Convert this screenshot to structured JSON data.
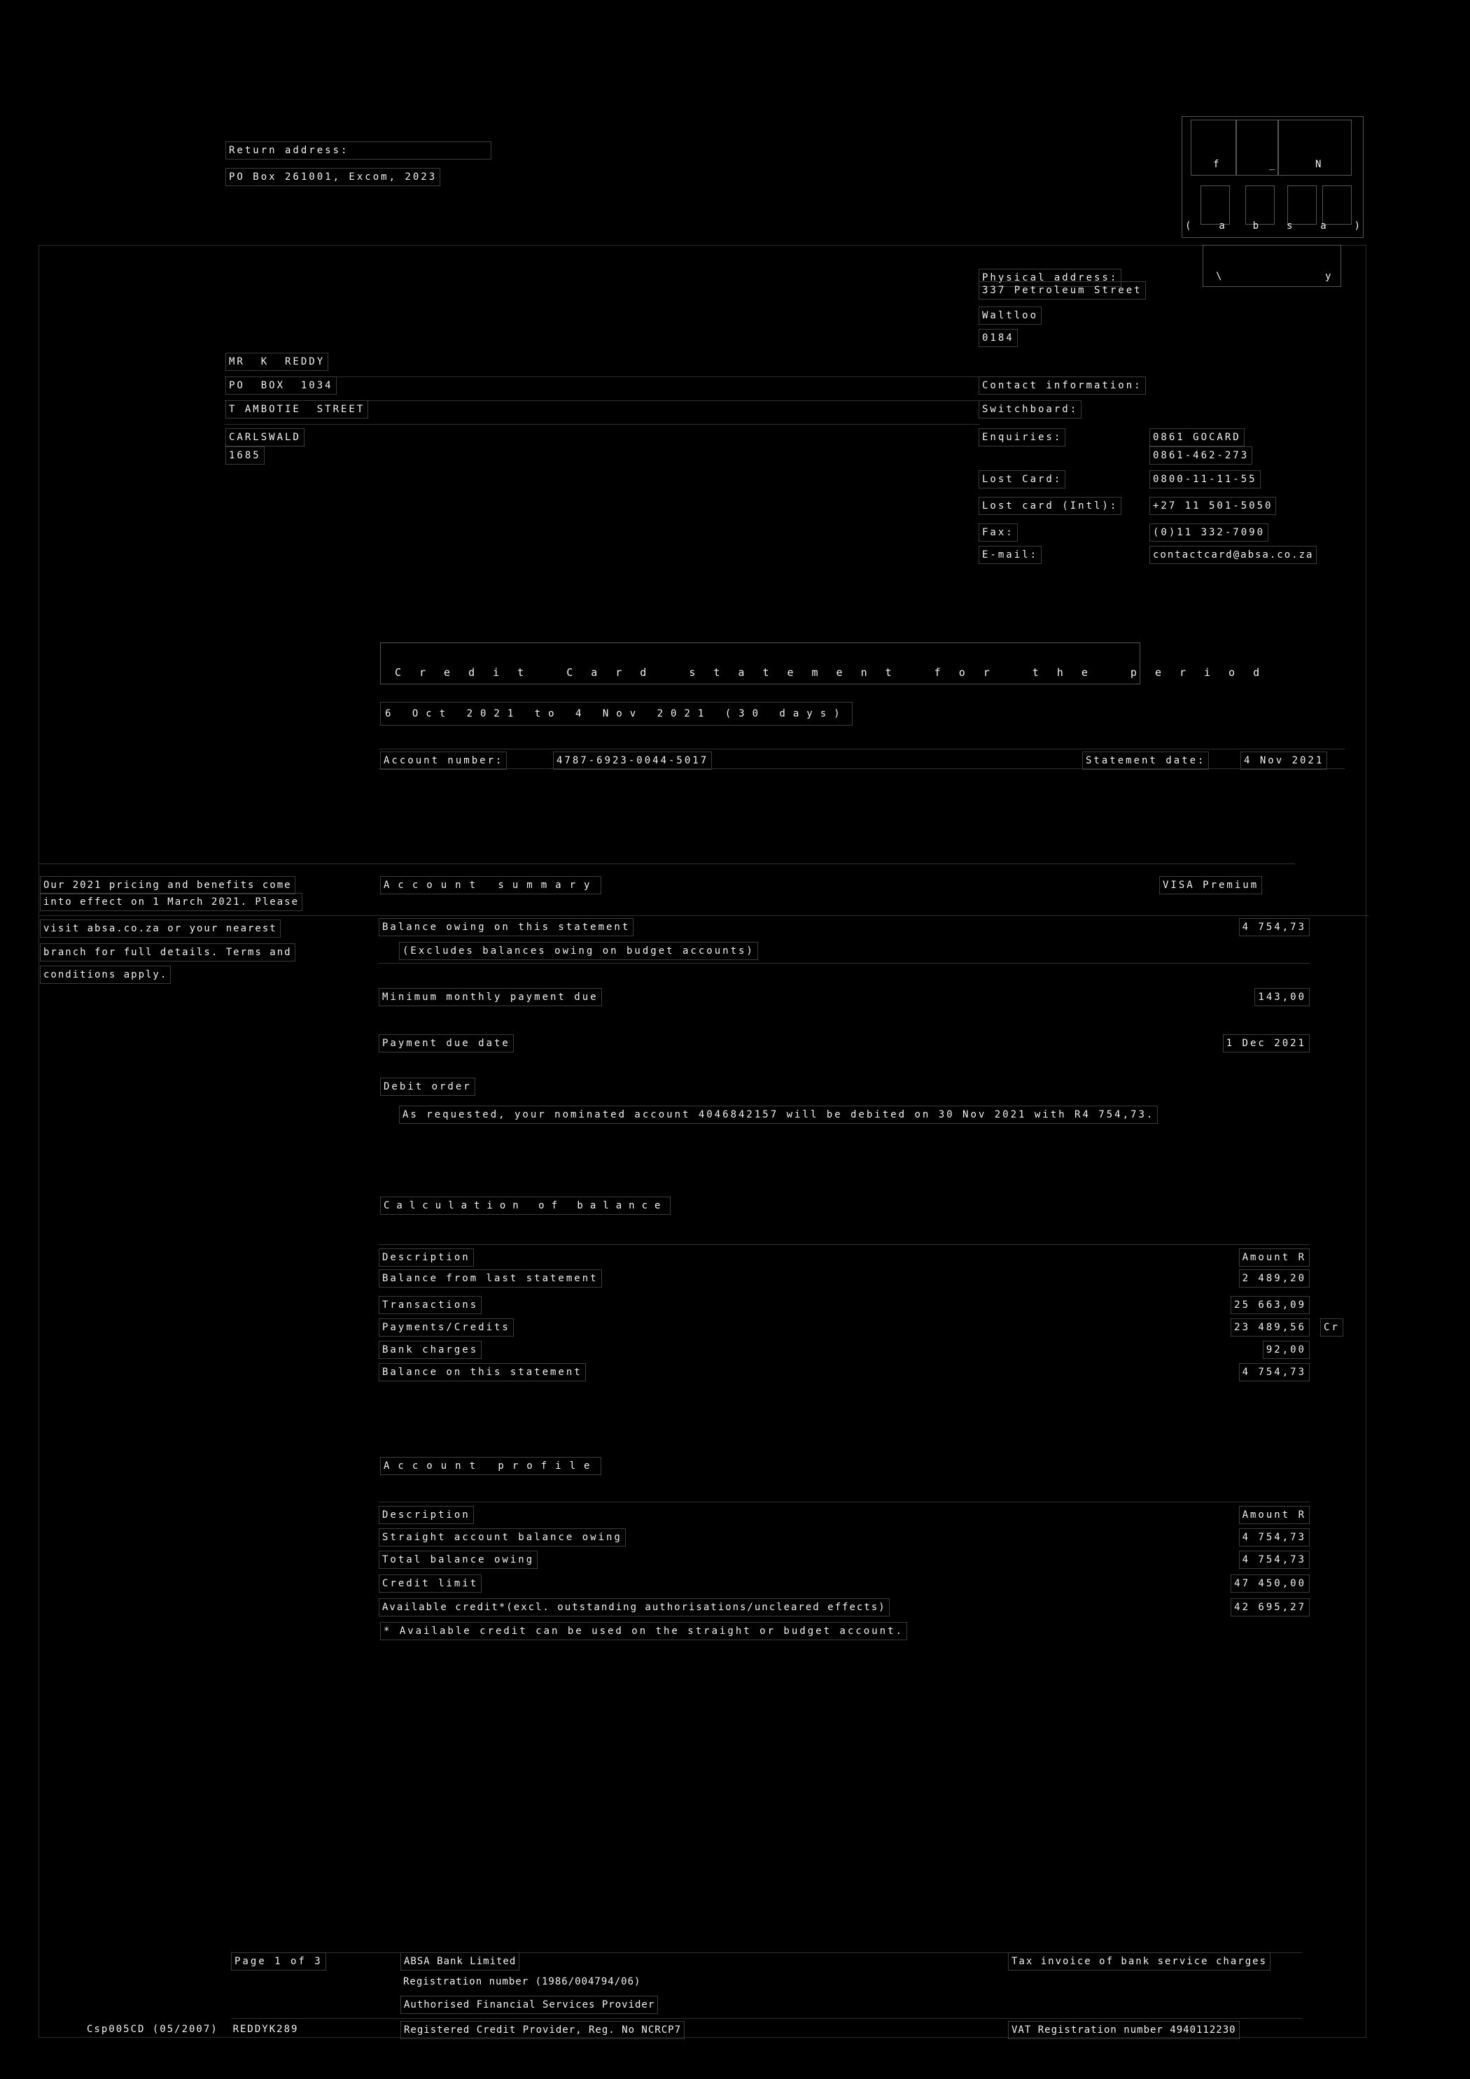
{
  "return_address": {
    "label": "Return address:",
    "value": "PO Box 261001, Excom, 2023"
  },
  "logo": {
    "glyphs_top": [
      "f",
      "_",
      "N"
    ],
    "brand_letters": [
      "(",
      "a",
      "b",
      "s",
      "a",
      ")"
    ],
    "marks": [
      "\\",
      "y"
    ]
  },
  "physical_address": {
    "label": "Physical address:",
    "lines": [
      "337 Petroleum Street",
      "Waltloo",
      "0184"
    ]
  },
  "recipient": {
    "lines": [
      "MR  K  REDDY",
      "PO  BOX  1034",
      "T AMBOTIE  STREET",
      "CARLSWALD",
      "1685"
    ]
  },
  "contact": {
    "heading": "Contact information:",
    "switchboard_label": "Switchboard:",
    "enquiries_label": "Enquiries:",
    "enquiries_values": [
      "0861 GOCARD",
      "0861-462-273"
    ],
    "lost_card_label": "Lost Card:",
    "lost_card_value": "0800-11-11-55",
    "lost_card_intl_label": "Lost card (Intl):",
    "lost_card_intl_value": "+27 11 501-5050",
    "fax_label": "Fax:",
    "fax_value": "(0)11 332-7090",
    "email_label": "E-mail:",
    "email_value": "contactcard@absa.co.za"
  },
  "statement": {
    "title": "Credit Card statement for the period",
    "period": "6 Oct 2021 to 4 Nov 2021 (30 days)",
    "account_number_label": "Account number:",
    "account_number": "4787-6923-0044-5017",
    "statement_date_label": "Statement date:",
    "statement_date": "4 Nov 2021"
  },
  "promo": {
    "lines": [
      "Our 2021 pricing and benefits come",
      "into effect on 1 March 2021. Please",
      "visit absa.co.za or your nearest",
      "branch for full details. Terms and",
      "conditions apply."
    ]
  },
  "account_summary": {
    "heading": "Account summary",
    "product": "VISA Premium",
    "balance_label": "Balance owing on this statement",
    "balance_value": "4 754,73",
    "balance_note": "(Excludes balances owing on budget accounts)",
    "min_payment_label": "Minimum monthly payment due",
    "min_payment_value": "143,00",
    "due_date_label": "Payment due date",
    "due_date_value": "1 Dec 2021",
    "debit_order_label": "Debit order",
    "debit_order_text": "As requested, your nominated account 4046842157 will be debited on 30 Nov 2021 with R4 754,73."
  },
  "calculation": {
    "heading": "Calculation of balance",
    "col_description": "Description",
    "col_amount": "Amount R",
    "rows": [
      {
        "desc": "Balance from last statement",
        "amount": "2 489,20",
        "flag": ""
      },
      {
        "desc": "Transactions",
        "amount": "25 663,09",
        "flag": ""
      },
      {
        "desc": "Payments/Credits",
        "amount": "23 489,56",
        "flag": "Cr"
      },
      {
        "desc": "Bank charges",
        "amount": "92,00",
        "flag": ""
      },
      {
        "desc": "Balance on this statement",
        "amount": "4 754,73",
        "flag": ""
      }
    ]
  },
  "profile": {
    "heading": "Account profile",
    "col_description": "Description",
    "col_amount": "Amount R",
    "rows": [
      {
        "desc": "Straight account balance owing",
        "amount": "4 754,73"
      },
      {
        "desc": "Total balance owing",
        "amount": "4 754,73"
      },
      {
        "desc": "Credit limit",
        "amount": "47 450,00"
      },
      {
        "desc": "Available credit*(excl. outstanding authorisations/uncleared effects)",
        "amount": "42 695,27"
      }
    ],
    "footnote": "* Available credit can be used on the straight or budget account."
  },
  "footer": {
    "page": "Page 1 of 3",
    "form_code": "Csp005CD (05/2007)  REDDYK289",
    "bank_lines": [
      "ABSA Bank Limited",
      "Registration number (1986/004794/06)",
      "Authorised Financial Services Provider",
      "Registered Credit Provider, Reg. No NCRCP7"
    ],
    "tax_invoice": "Tax invoice of bank service charges",
    "vat": "VAT Registration number 4940112230"
  }
}
